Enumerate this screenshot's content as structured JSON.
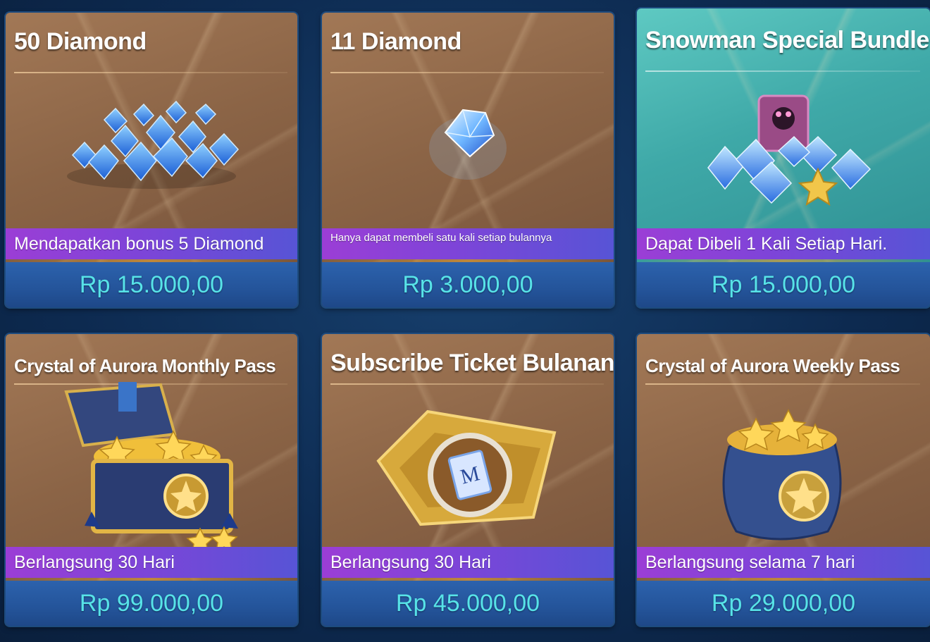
{
  "shop": {
    "items": [
      {
        "title": "50 Diamond",
        "info": "Mendapatkan bonus 5 Diamond",
        "price": "Rp 15.000,00",
        "icon": "diamond-pile-icon"
      },
      {
        "title": "11 Diamond",
        "info": "Hanya dapat membeli satu kali setiap bulannya",
        "price": "Rp 3.000,00",
        "icon": "single-diamond-icon"
      },
      {
        "title": "Snowman Special Bundle",
        "info": "Dapat Dibeli 1 Kali Setiap Hari.",
        "price": "Rp 15.000,00",
        "icon": "snowman-bundle-icon"
      },
      {
        "title": "Crystal of Aurora Monthly Pass",
        "info": "Berlangsung 30 Hari",
        "price": "Rp 99.000,00",
        "icon": "treasure-chest-icon"
      },
      {
        "title": "Subscribe Ticket Bulanan",
        "info": "Berlangsung 30 Hari",
        "price": "Rp 45.000,00",
        "icon": "ticket-icon"
      },
      {
        "title": "Crystal of Aurora Weekly Pass",
        "info": "Berlangsung selama 7 hari",
        "price": "Rp 29.000,00",
        "icon": "coin-bag-icon"
      }
    ]
  },
  "colors": {
    "card_brown": "#8b6446",
    "card_teal": "#3fa9a8",
    "info_purple": "#9b3ed6",
    "price_blue": "#24549a",
    "price_text": "#57e3e8"
  }
}
